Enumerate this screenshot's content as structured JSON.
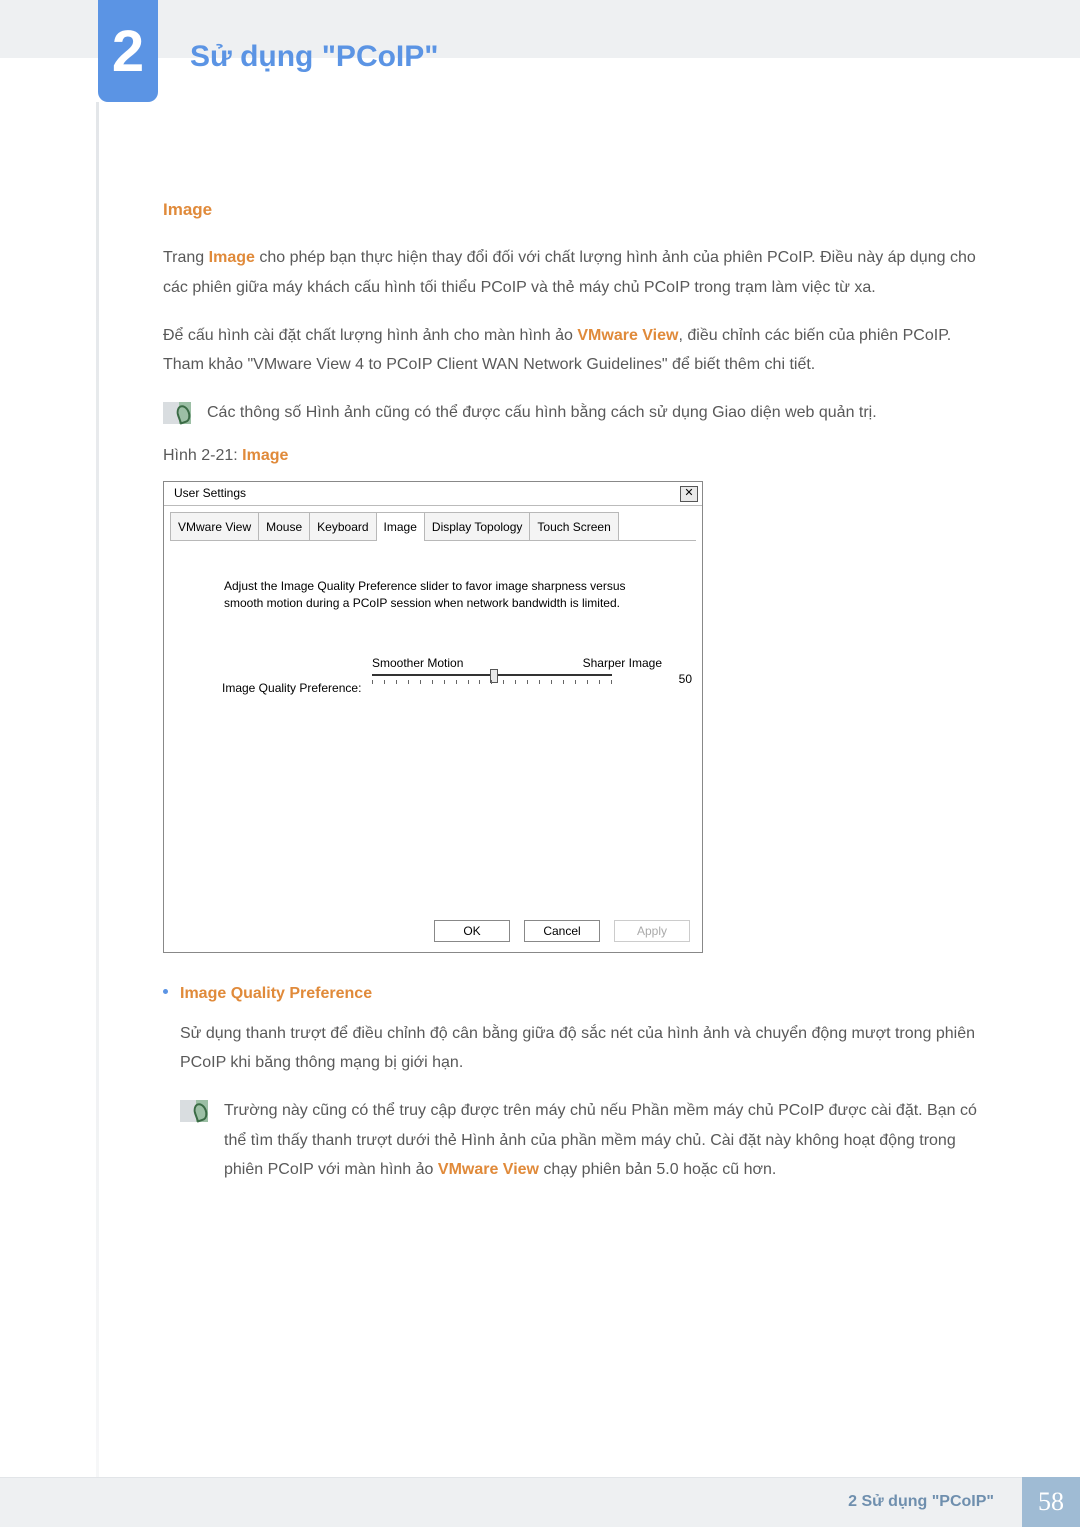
{
  "chapter": {
    "number": "2",
    "title": "Sử dụng \"PCoIP\""
  },
  "section": {
    "title": "Image",
    "p1a": "Trang ",
    "p1b": "Image",
    "p1c": " cho phép bạn thực hiện thay đổi đối với chất lượng hình ảnh của phiên PCoIP. Điều này áp dụng cho các phiên giữa máy khách cấu hình tối thiểu PCoIP và thẻ máy chủ PCoIP trong trạm làm việc từ xa.",
    "p2a": "Để cấu hình cài đặt chất lượng hình ảnh cho màn hình ảo ",
    "p2b": "VMware View",
    "p2c": ", điều chỉnh các biến của phiên PCoIP. Tham khảo \"VMware View 4 to PCoIP Client WAN Network Guidelines\" để biết thêm chi tiết.",
    "note1": "Các thông số Hình ảnh cũng có thể được cấu hình bằng cách sử dụng Giao diện web quản trị.",
    "fig_label_a": "Hình 2-21: ",
    "fig_label_b": "Image"
  },
  "screenshot": {
    "window_title": "User Settings",
    "tabs": [
      "VMware View",
      "Mouse",
      "Keyboard",
      "Image",
      "Display Topology",
      "Touch Screen"
    ],
    "active_tab_index": 3,
    "description": "Adjust the Image Quality Preference slider to favor image sharpness versus smooth motion during a PCoIP session when network bandwidth is limited.",
    "slider": {
      "label": "Image Quality Preference:",
      "left_label": "Smoother Motion",
      "right_label": "Sharper Image",
      "value": "50"
    },
    "buttons": {
      "ok": "OK",
      "cancel": "Cancel",
      "apply": "Apply"
    }
  },
  "sub": {
    "title": "Image Quality Preference",
    "p1": "Sử dụng thanh trượt để điều chỉnh độ cân bằng giữa độ sắc nét của hình ảnh và chuyển động mượt trong phiên PCoIP khi băng thông mạng bị giới hạn.",
    "note_a": "Trường này cũng có thể truy cập được trên máy chủ nếu Phần mềm máy chủ PCoIP được cài đặt. Bạn có thể tìm thấy thanh trượt dưới thẻ Hình ảnh của phần mềm máy chủ. Cài đặt này không hoạt động trong phiên PCoIP với màn hình ảo ",
    "note_b": "VMware View",
    "note_c": " chạy phiên bản 5.0 hoặc cũ hơn."
  },
  "footer": {
    "chapter_ref": "2 Sử dụng \"PCoIP\"",
    "page": "58"
  }
}
